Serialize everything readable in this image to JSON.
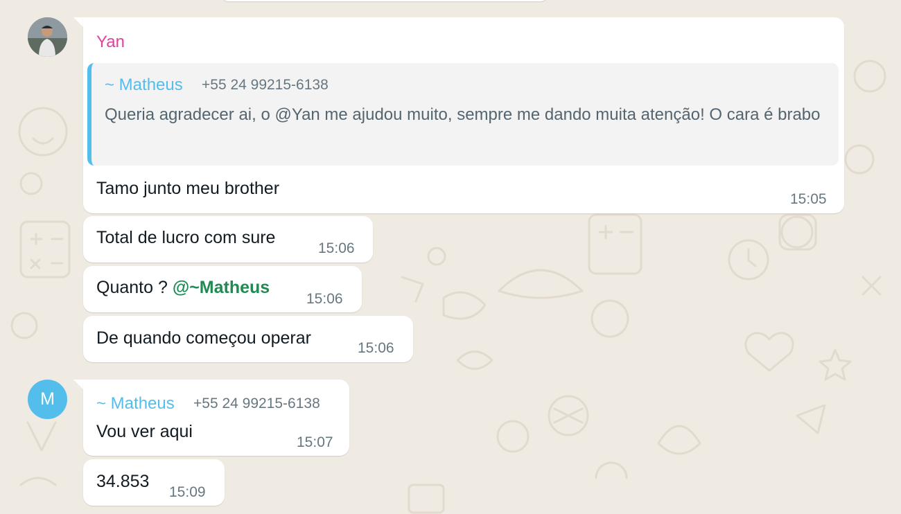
{
  "colors": {
    "background": "#efeae2",
    "bubble": "#ffffff",
    "sender_yan": "#e0429a",
    "sender_matheus": "#53bdeb",
    "mention": "#1f8a53",
    "meta_text": "#667781"
  },
  "icons": {
    "avatar_yan": "user-photo-avatar",
    "avatar_matheus": "letter-avatar"
  },
  "messages": {
    "m1": {
      "sender": "Yan",
      "quote": {
        "sender": "~ Matheus",
        "phone": "+55 24 99215-6138",
        "text": "Queria agradecer ai, o @Yan me ajudou muito, sempre me dando muita atenção! O cara é brabo"
      },
      "text": "Tamo junto meu brother",
      "time": "15:05"
    },
    "m2": {
      "text": "Total de lucro com sure",
      "time": "15:06"
    },
    "m3": {
      "text_prefix": "Quanto ? ",
      "mention": "@~Matheus",
      "time": "15:06"
    },
    "m4": {
      "text": "De quando começou operar",
      "time": "15:06"
    },
    "m5": {
      "avatar_letter": "M",
      "sender": "~ Matheus",
      "phone": "+55 24 99215-6138",
      "text": "Vou ver aqui",
      "time": "15:07"
    },
    "m6": {
      "text": "34.853",
      "time": "15:09"
    }
  }
}
